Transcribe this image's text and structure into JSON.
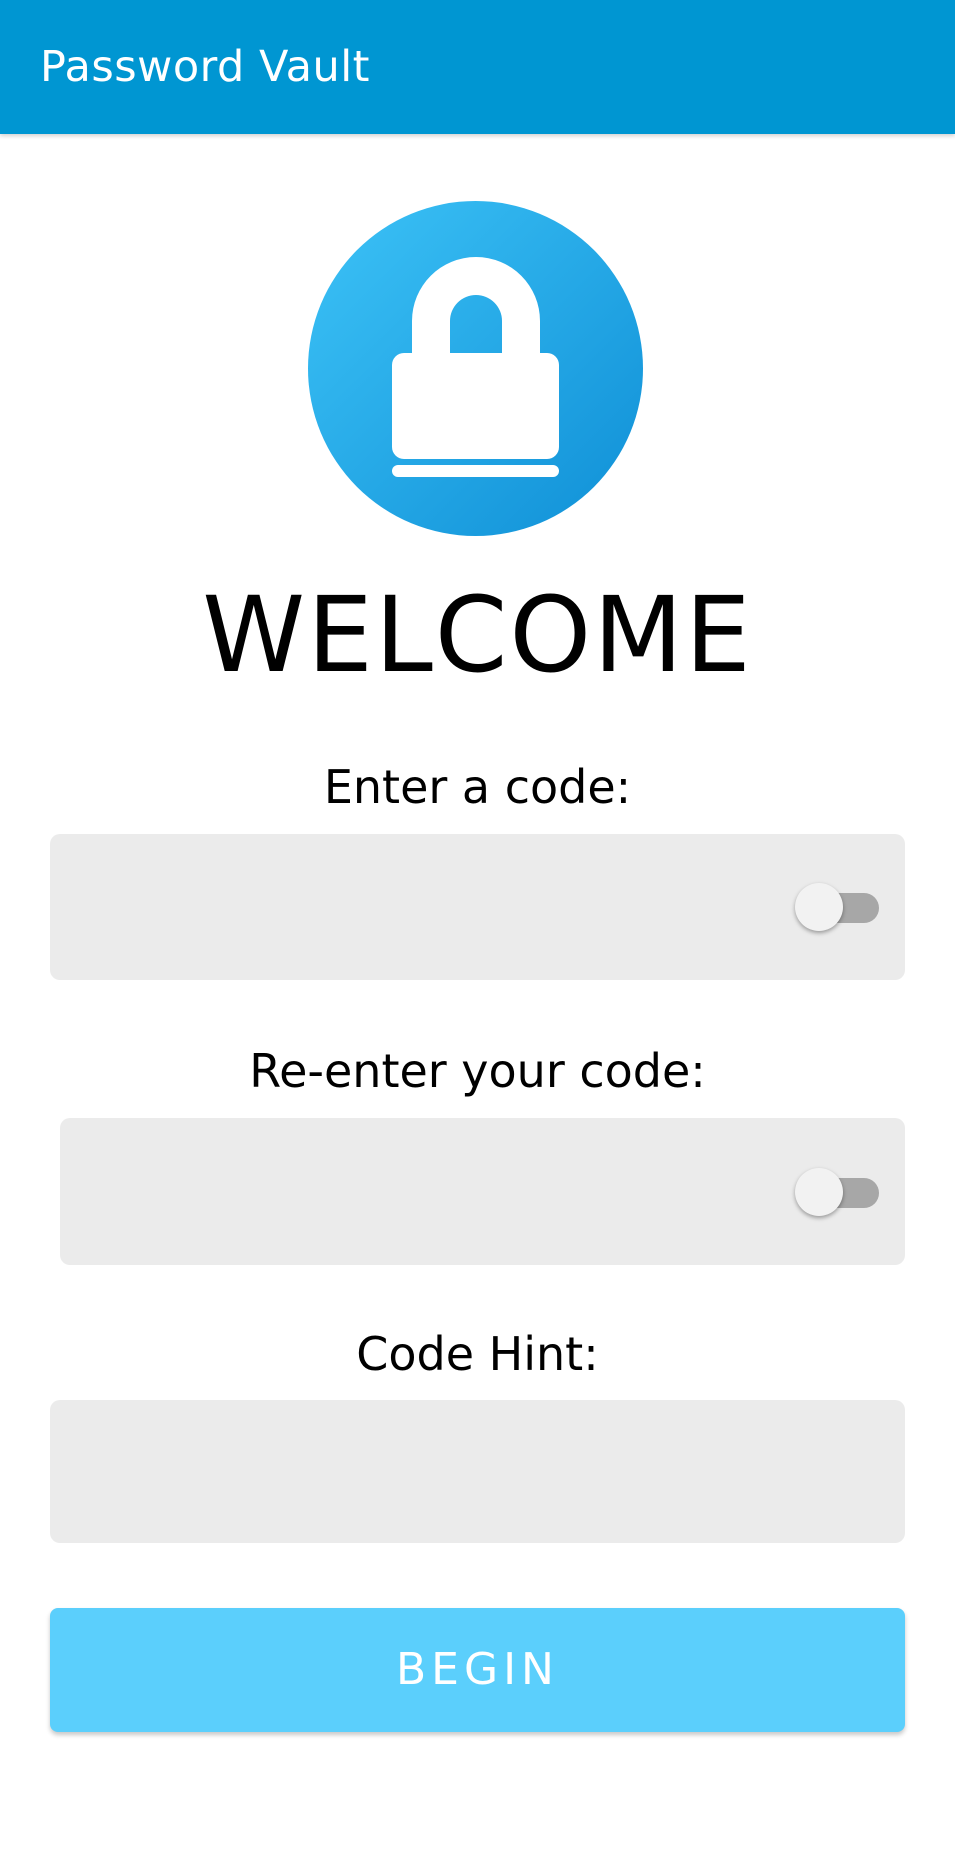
{
  "app_bar": {
    "title": "Password Vault",
    "color": "#0096d2"
  },
  "logo": {
    "icon": "padlock-icon",
    "colors": [
      "#3dc3f7",
      "#0f8fd6"
    ]
  },
  "welcome": "WELCOME",
  "form": {
    "code_label": "Enter a code:",
    "code_value": "",
    "reenter_label": "Re-enter your code:",
    "reenter_value": "",
    "hint_label": "Code Hint:",
    "hint_value": "",
    "show_code_toggle": false,
    "show_reenter_toggle": false
  },
  "begin_button": {
    "label": "BEGIN",
    "color": "#5bcffc"
  }
}
